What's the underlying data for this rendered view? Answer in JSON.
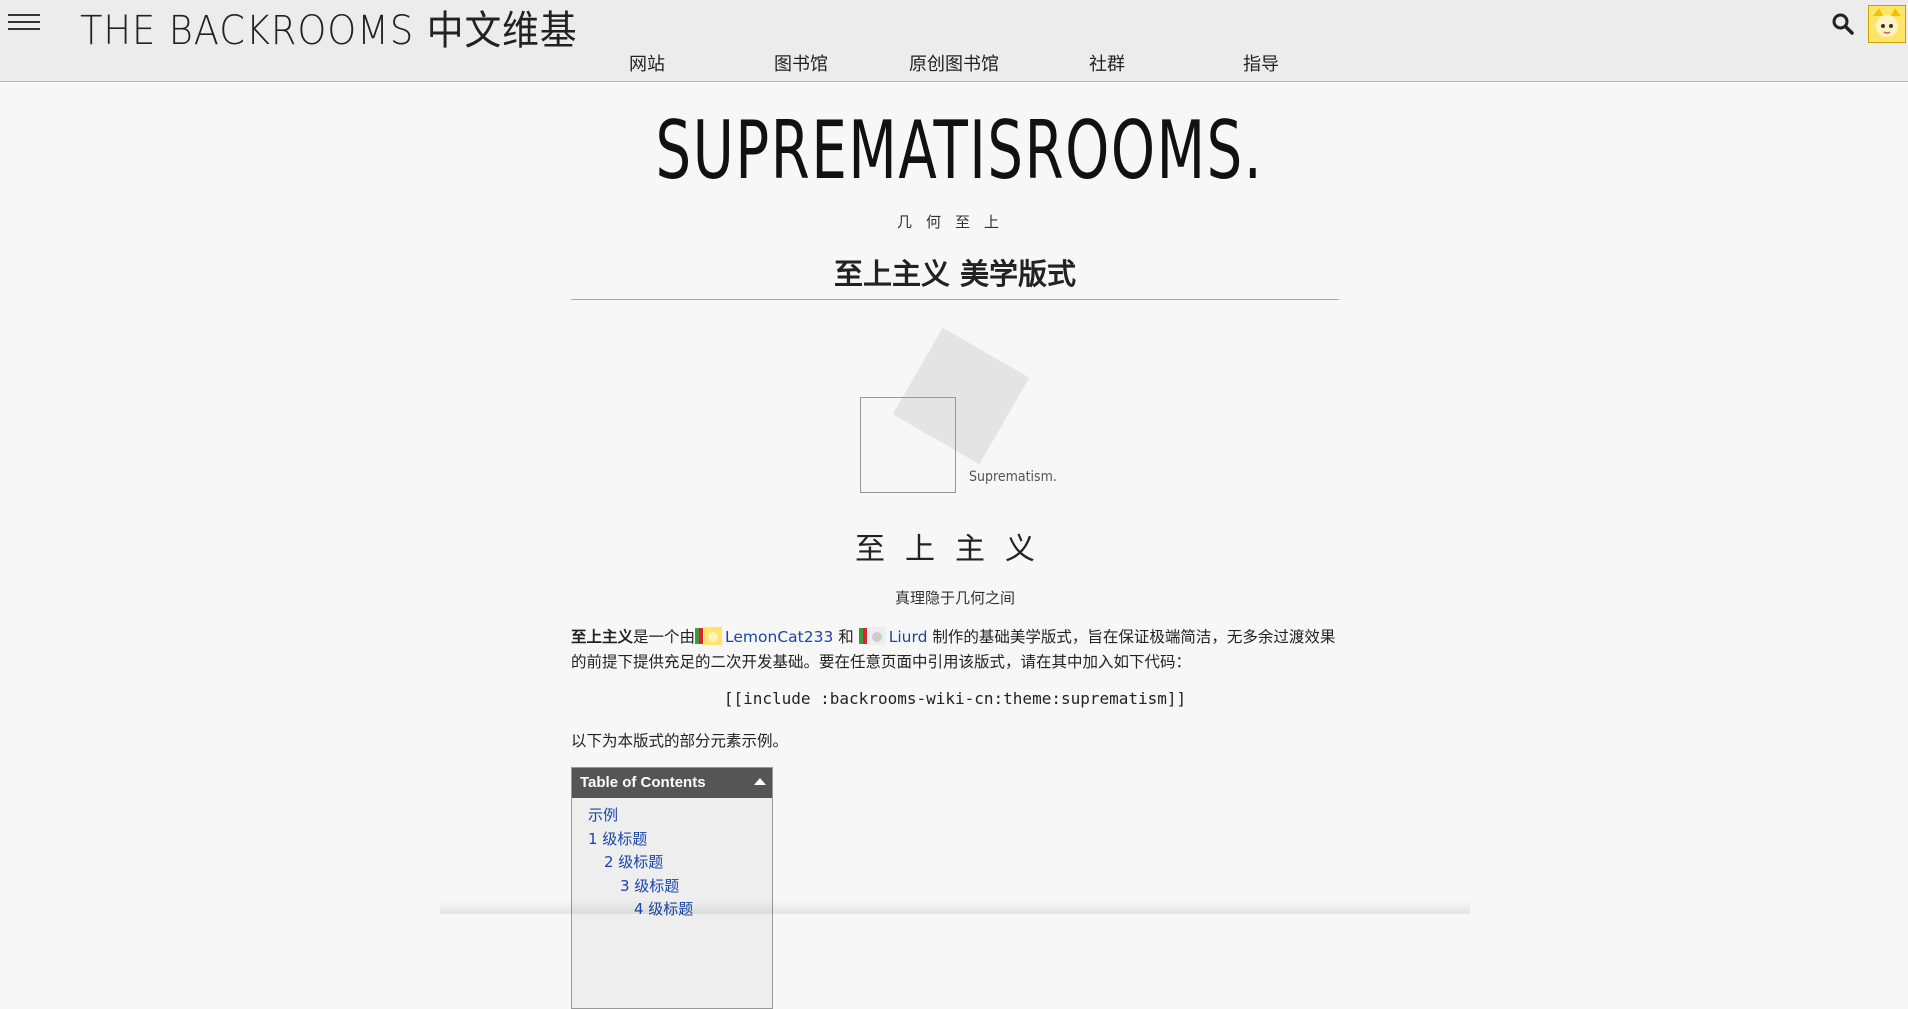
{
  "header": {
    "site_title": "THE BACKROOMS 中文维基",
    "nav": [
      "网站",
      "图书馆",
      "原创图书馆",
      "社群",
      "指导"
    ],
    "icons": {
      "menu": "hamburger-menu-icon",
      "search": "search-icon",
      "avatar": "user-avatar"
    }
  },
  "hero": {
    "title": "SUPREMATISROOMS.",
    "subtitle": "几何至上"
  },
  "section": {
    "heading": "至上主义 美学版式"
  },
  "logo": {
    "caption": "Suprematism."
  },
  "theme": {
    "title": "至上主义",
    "tagline": "真理隐于几何之间"
  },
  "intro": {
    "bold": "至上主义",
    "text1": "是一个由",
    "user1": "LemonCat233",
    "and": "和",
    "user2": "Liurd",
    "text2": "制作的基础美学版式，旨在保证极端简洁，无多余过渡效果的前提下提供充足的二次开发基础。要在任意页面中引用该版式，请在其中加入如下代码："
  },
  "code": "[[include :backrooms-wiki-cn:theme:suprematism]]",
  "note": "以下为本版式的部分元素示例。",
  "toc": {
    "title": "Table of Contents",
    "items": [
      {
        "label": "示例",
        "level": 0
      },
      {
        "label": "1 级标题",
        "level": 0
      },
      {
        "label": "2 级标题",
        "level": 1
      },
      {
        "label": "3 级标题",
        "level": 2
      },
      {
        "label": "4 级标题",
        "level": 3
      }
    ]
  },
  "colors": {
    "link": "#1a45a8",
    "toc_header": "#555555",
    "background": "#f7f7f7"
  }
}
